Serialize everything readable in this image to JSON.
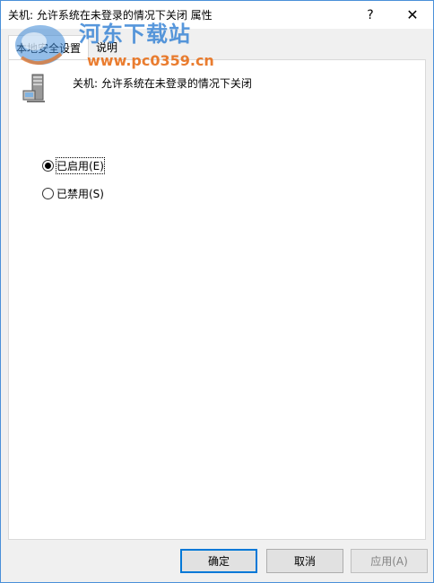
{
  "window": {
    "title": "关机: 允许系统在未登录的情况下关闭 属性",
    "help_symbol": "?",
    "close_symbol": "✕"
  },
  "tabs": [
    {
      "label": "本地安全设置",
      "active": true
    },
    {
      "label": "说明",
      "active": false
    }
  ],
  "policy": {
    "name": "关机: 允许系统在未登录的情况下关闭",
    "icon": "server-icon"
  },
  "options": [
    {
      "label": "已启用(E)",
      "checked": true
    },
    {
      "label": "已禁用(S)",
      "checked": false
    }
  ],
  "buttons": {
    "ok": "确定",
    "cancel": "取消",
    "apply": "应用(A)"
  },
  "watermark": {
    "title": "河东下载站",
    "url": "www.pc0359.cn"
  }
}
